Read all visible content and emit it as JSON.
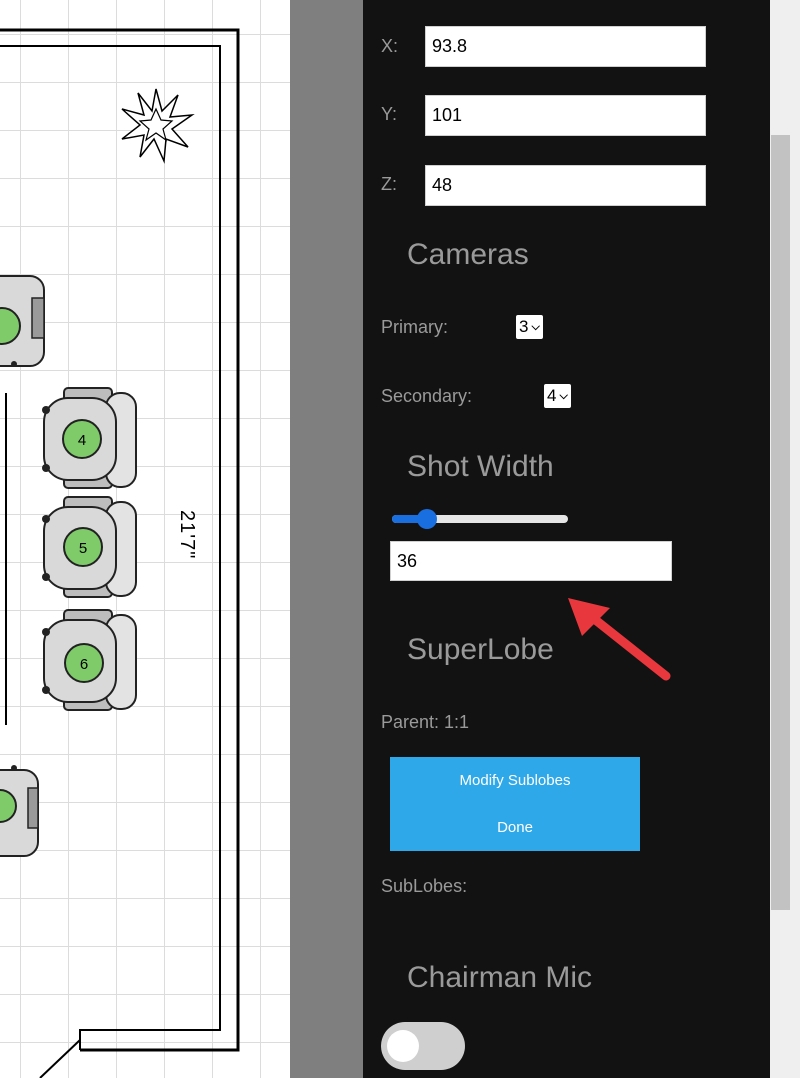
{
  "floorplan": {
    "dimension_label": "21'7\"",
    "seats": [
      {
        "number": "4"
      },
      {
        "number": "5"
      },
      {
        "number": "6"
      }
    ]
  },
  "panel": {
    "position": {
      "x_label": "X:",
      "x_value": "93.8",
      "y_label": "Y:",
      "y_value": "101",
      "z_label": "Z:",
      "z_value": "48"
    },
    "cameras": {
      "heading": "Cameras",
      "primary_label": "Primary:",
      "primary_value": "3",
      "secondary_label": "Secondary:",
      "secondary_value": "4"
    },
    "shot_width": {
      "heading": "Shot Width",
      "slider_level": 0.2,
      "value": "36"
    },
    "superlobe": {
      "heading": "SuperLobe",
      "parent_label": "Parent: 1:1",
      "modify_label": "Modify Sublobes",
      "done_label": "Done",
      "sublobes_label": "SubLobes:"
    },
    "chairman": {
      "heading": "Chairman Mic",
      "toggle_on": false
    }
  },
  "colors": {
    "panel_bg": "#121212",
    "accent_blue": "#2ea8e8",
    "slider_blue": "#1a6fe0",
    "annotation_red": "#e8383d",
    "seat_green": "#7fcb6a"
  }
}
